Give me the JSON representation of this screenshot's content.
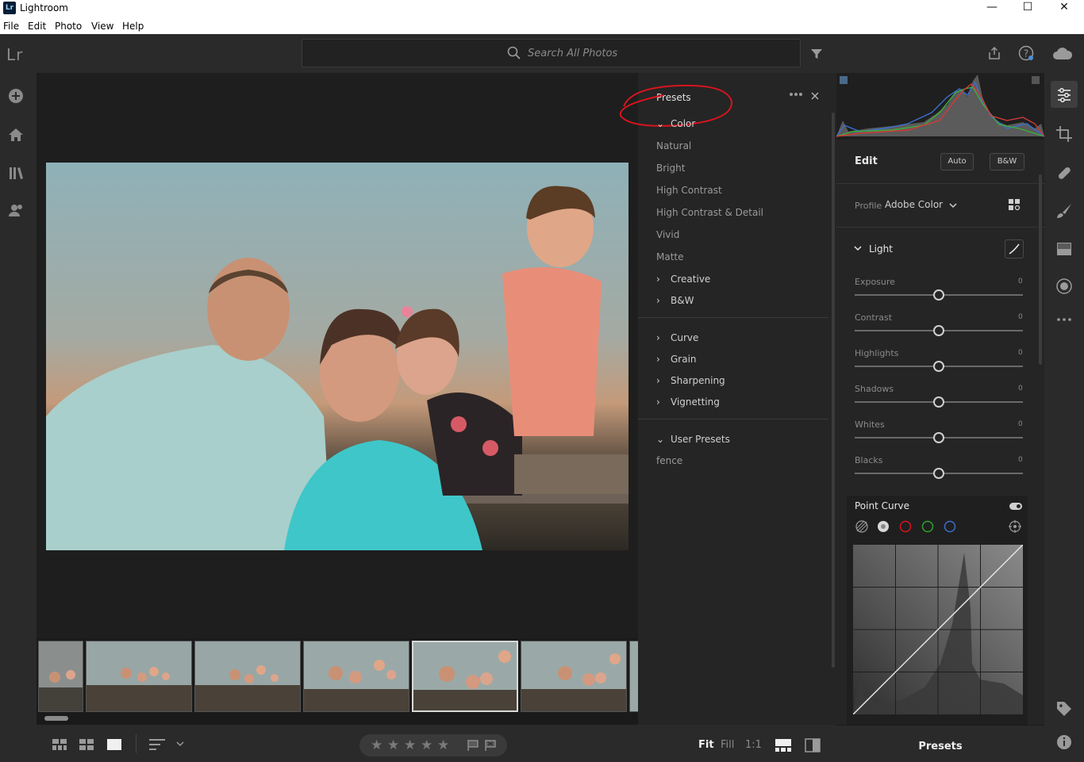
{
  "window": {
    "title": "Lightroom",
    "app_icon": "Lr",
    "minimize": "—",
    "maximize": "☐",
    "close": "✕"
  },
  "menu": [
    "File",
    "Edit",
    "Photo",
    "View",
    "Help"
  ],
  "toolbar": {
    "logo": "Lr",
    "search_placeholder": "Search All Photos"
  },
  "presets": {
    "header": "Presets",
    "color_group": "Color",
    "color_items": [
      "Natural",
      "Bright",
      "High Contrast",
      "High Contrast & Detail",
      "Vivid",
      "Matte"
    ],
    "groups_a": [
      "Creative",
      "B&W"
    ],
    "groups_b": [
      "Curve",
      "Grain",
      "Sharpening",
      "Vignetting"
    ],
    "user_group": "User Presets",
    "user_items": [
      "fence"
    ]
  },
  "edit": {
    "header": "Edit",
    "auto_label": "Auto",
    "bw_label": "B&W",
    "profile_label": "Profile",
    "profile_value": "Adobe Color",
    "light_header": "Light",
    "sliders": [
      {
        "label": "Exposure",
        "value": "0"
      },
      {
        "label": "Contrast",
        "value": "0"
      },
      {
        "label": "Highlights",
        "value": "0"
      },
      {
        "label": "Shadows",
        "value": "0"
      },
      {
        "label": "Whites",
        "value": "0"
      },
      {
        "label": "Blacks",
        "value": "0"
      }
    ],
    "point_curve_header": "Point Curve",
    "footer": "Presets"
  },
  "bottombar": {
    "stars": [
      "★",
      "★",
      "★",
      "★",
      "★"
    ],
    "zoom_fit": "Fit",
    "zoom_fill": "Fill",
    "zoom_1to1": "1:1"
  },
  "colors": {
    "accent": "#e0e0e0",
    "annotation": "#d8141e"
  }
}
